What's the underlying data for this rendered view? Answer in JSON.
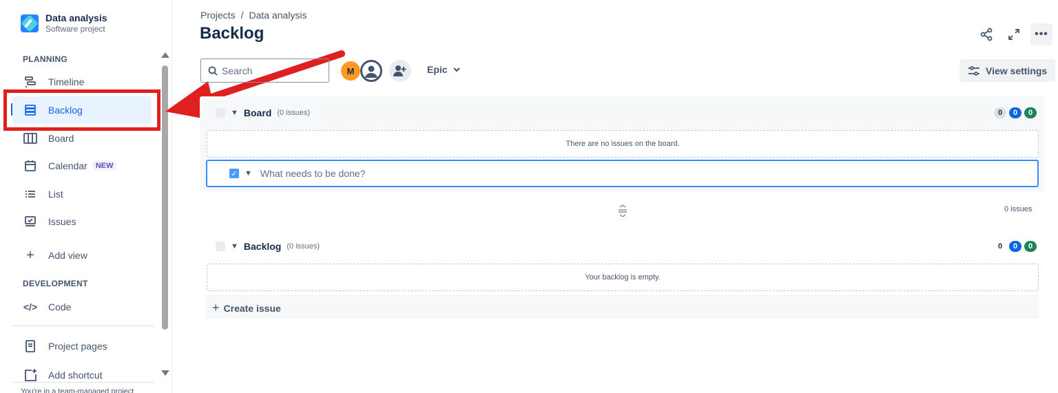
{
  "project": {
    "name": "Data analysis",
    "type": "Software project"
  },
  "sidebar": {
    "planning_label": "PLANNING",
    "development_label": "DEVELOPMENT",
    "items": [
      {
        "label": "Timeline",
        "icon": "timeline-icon"
      },
      {
        "label": "Backlog",
        "icon": "backlog-icon",
        "active": true
      },
      {
        "label": "Board",
        "icon": "board-icon"
      },
      {
        "label": "Calendar",
        "icon": "calendar-icon",
        "badge": "NEW"
      },
      {
        "label": "List",
        "icon": "list-icon"
      },
      {
        "label": "Issues",
        "icon": "issues-icon"
      },
      {
        "label": "Add view",
        "icon": "plus-icon"
      }
    ],
    "dev_items": [
      {
        "label": "Code",
        "icon": "code-icon"
      }
    ],
    "bottom_items": [
      {
        "label": "Project pages",
        "icon": "page-icon"
      },
      {
        "label": "Add shortcut",
        "icon": "add-shortcut-icon"
      }
    ],
    "cut_text": "You're in a team-managed project"
  },
  "header": {
    "breadcrumb": [
      "Projects",
      "/",
      "Data analysis"
    ],
    "title": "Backlog"
  },
  "toolbar": {
    "search_placeholder": "Search",
    "avatar_initial": "M",
    "epic_label": "Epic",
    "view_settings_label": "View settings"
  },
  "board_section": {
    "title": "Board",
    "count": "(0 issues)",
    "pills": [
      "0",
      "0",
      "0"
    ],
    "empty_text": "There are no issues on the board.",
    "new_issue_placeholder": "What needs to be done?"
  },
  "issues_total": "0 issues",
  "backlog_section": {
    "title": "Backlog",
    "count": "(0 issues)",
    "pills": [
      "0",
      "0",
      "0"
    ],
    "empty_text": "Your backlog is empty.",
    "create_label": "Create issue"
  },
  "colors": {
    "accent": "#0c66e4",
    "annotation": "#e02020"
  }
}
